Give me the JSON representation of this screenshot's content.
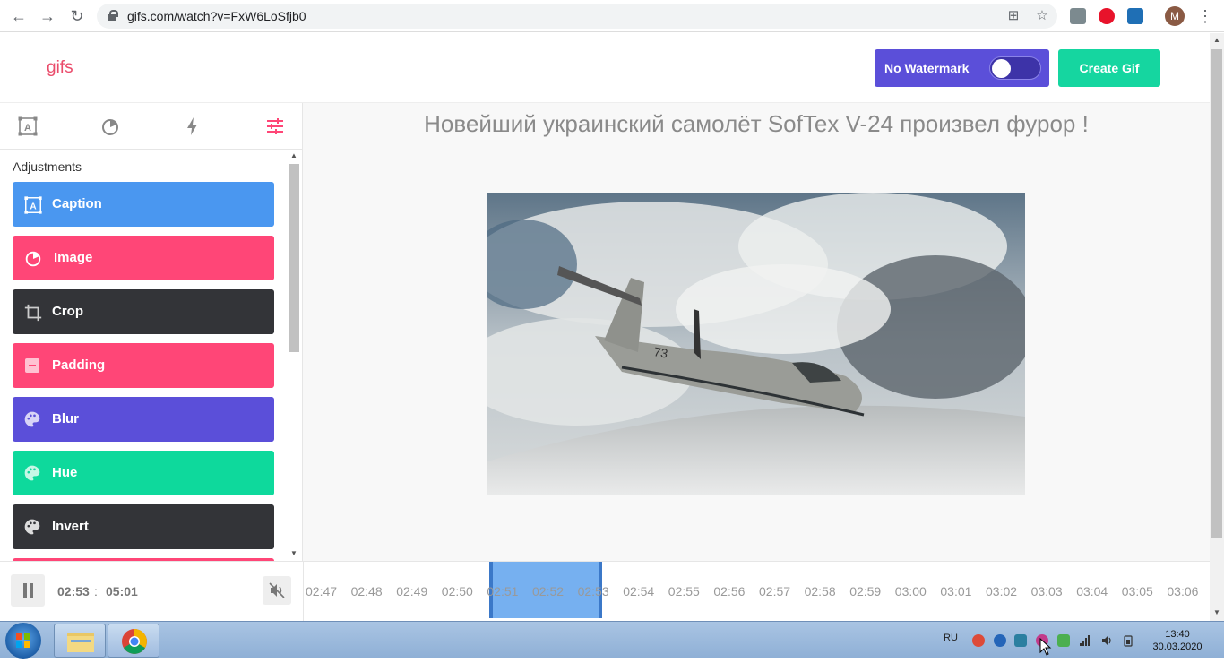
{
  "browser": {
    "url": "gifs.com/watch?v=FxW6LoSfjb0",
    "avatar_letter": "M"
  },
  "header": {
    "logo": "gifs",
    "watermark_label": "No Watermark",
    "watermark_enabled": false,
    "create_label": "Create Gif"
  },
  "sidebar": {
    "tab_icons": [
      "caption-tab-icon",
      "image-tab-icon",
      "effects-tab-icon",
      "adjustments-tab-icon"
    ],
    "section_title": "Adjustments",
    "tools": [
      {
        "label": "Caption",
        "color": "#4a97f0",
        "icon": "caption-icon"
      },
      {
        "label": "Image",
        "color": "#ff4677",
        "icon": "image-icon"
      },
      {
        "label": "Crop",
        "color": "#333438",
        "icon": "crop-icon"
      },
      {
        "label": "Padding",
        "color": "#ff4677",
        "icon": "padding-icon"
      },
      {
        "label": "Blur",
        "color": "#5b4fd9",
        "icon": "palette-icon"
      },
      {
        "label": "Hue",
        "color": "#0ed99c",
        "icon": "palette-icon"
      },
      {
        "label": "Invert",
        "color": "#333438",
        "icon": "palette-icon"
      }
    ]
  },
  "main": {
    "title": "Новейший украинский самолёт SofTex V-24 произвел фурор !"
  },
  "player": {
    "current_time": "02:53",
    "separator": ":",
    "total_time": "05:01",
    "ticks": [
      "02:47",
      "02:48",
      "02:49",
      "02:50",
      "02:51",
      "02:52",
      "02:53",
      "02:54",
      "02:55",
      "02:56",
      "02:57",
      "02:58",
      "02:59",
      "03:00",
      "03:01",
      "03:02",
      "03:03",
      "03:04",
      "03:05",
      "03:06"
    ],
    "selection_start": "02:51",
    "selection_end": "02:53"
  },
  "taskbar": {
    "language": "RU",
    "time": "13:40",
    "date": "30.03.2020"
  }
}
